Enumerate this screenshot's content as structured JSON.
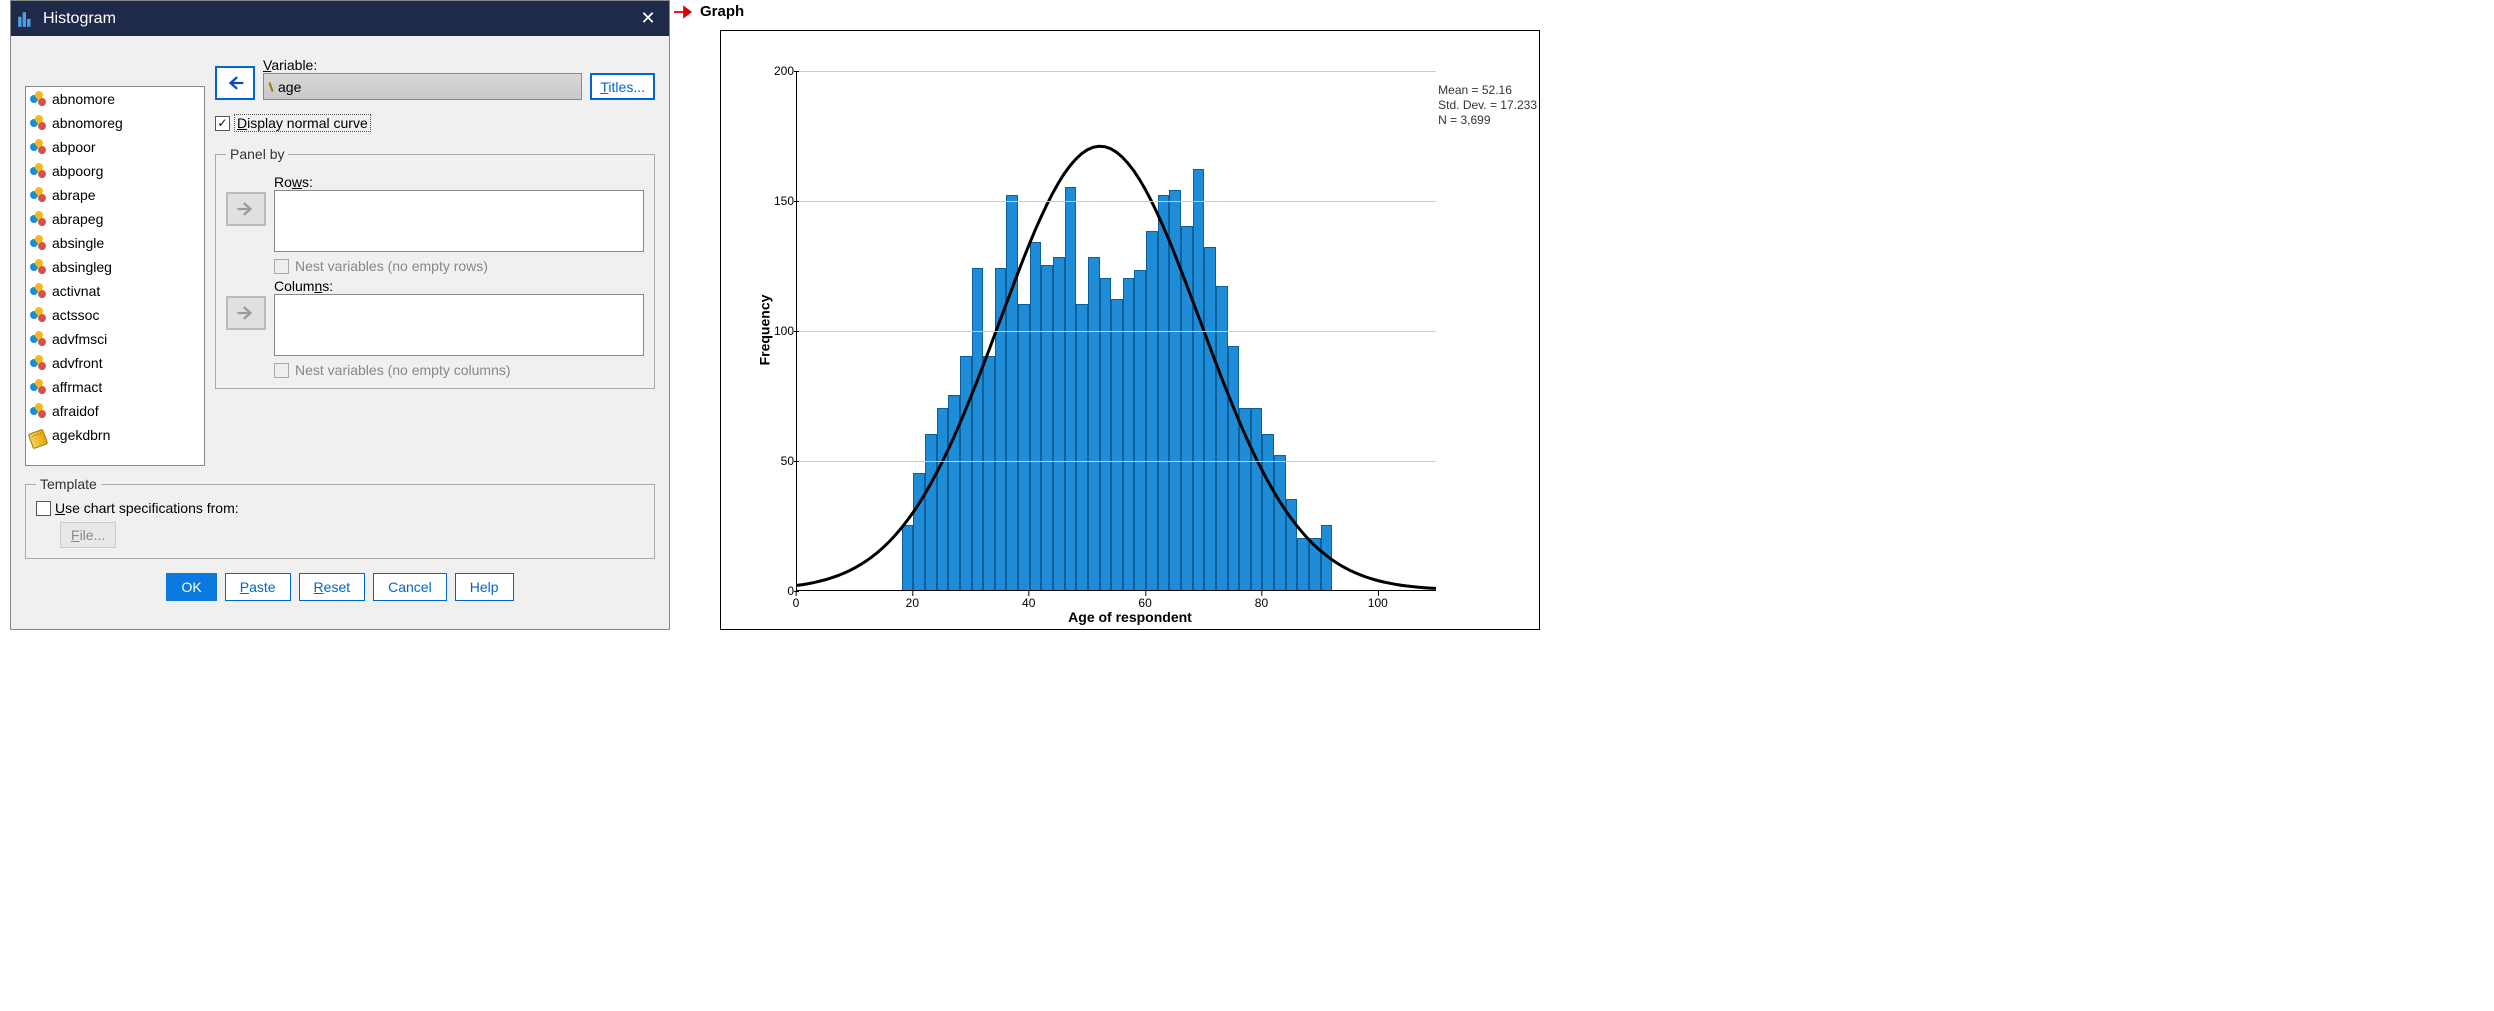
{
  "dialog": {
    "title": "Histogram",
    "variable_label": "Variable:",
    "variable_value": "age",
    "titles_btn": "Titles...",
    "display_normal": "Display normal curve",
    "display_normal_checked": true,
    "panel_by": "Panel by",
    "rows_label": "Rows:",
    "nest_rows": "Nest variables (no empty rows)",
    "cols_label": "Columns:",
    "nest_cols": "Nest variables (no empty columns)",
    "template_label": "Template",
    "use_chart_spec": "Use chart specifications from:",
    "file_btn": "File...",
    "buttons": {
      "ok": "OK",
      "paste": "Paste",
      "reset": "Reset",
      "cancel": "Cancel",
      "help": "Help"
    },
    "varlist": [
      {
        "name": "abnomore",
        "type": "nominal"
      },
      {
        "name": "abnomoreg",
        "type": "nominal"
      },
      {
        "name": "abpoor",
        "type": "nominal"
      },
      {
        "name": "abpoorg",
        "type": "nominal"
      },
      {
        "name": "abrape",
        "type": "nominal"
      },
      {
        "name": "abrapeg",
        "type": "nominal"
      },
      {
        "name": "absingle",
        "type": "nominal"
      },
      {
        "name": "absingleg",
        "type": "nominal"
      },
      {
        "name": "activnat",
        "type": "nominal"
      },
      {
        "name": "actssoc",
        "type": "nominal"
      },
      {
        "name": "advfmsci",
        "type": "nominal"
      },
      {
        "name": "advfront",
        "type": "nominal"
      },
      {
        "name": "affrmact",
        "type": "nominal"
      },
      {
        "name": "afraidof",
        "type": "nominal"
      },
      {
        "name": "agekdbrn",
        "type": "scale"
      }
    ]
  },
  "arrow_label": "Graph",
  "stats": {
    "mean": "Mean = 52.16",
    "sd": "Std. Dev. = 17.233",
    "n": "N = 3,699"
  },
  "chart_data": {
    "type": "bar",
    "title": "",
    "xlabel": "Age of respondent",
    "ylabel": "Frequency",
    "xlim": [
      0,
      110
    ],
    "ylim": [
      0,
      200
    ],
    "xticks": [
      0,
      20,
      40,
      60,
      80,
      100
    ],
    "yticks": [
      0,
      50,
      100,
      150,
      200
    ],
    "bin_width": 2,
    "categories": [
      18,
      20,
      22,
      24,
      26,
      28,
      30,
      32,
      34,
      36,
      38,
      40,
      42,
      44,
      46,
      48,
      50,
      52,
      54,
      56,
      58,
      60,
      62,
      64,
      66,
      68,
      70,
      72,
      74,
      76,
      78,
      80,
      82,
      84,
      86,
      88,
      90
    ],
    "values": [
      25,
      45,
      60,
      70,
      75,
      90,
      124,
      90,
      124,
      152,
      110,
      134,
      125,
      128,
      155,
      110,
      128,
      120,
      112,
      120,
      123,
      138,
      152,
      154,
      140,
      162,
      132,
      117,
      94,
      70,
      70,
      60,
      52,
      35,
      20,
      20,
      25
    ],
    "normal_curve": {
      "mean": 52.16,
      "sd": 17.233,
      "peak_frequency": 171
    }
  }
}
